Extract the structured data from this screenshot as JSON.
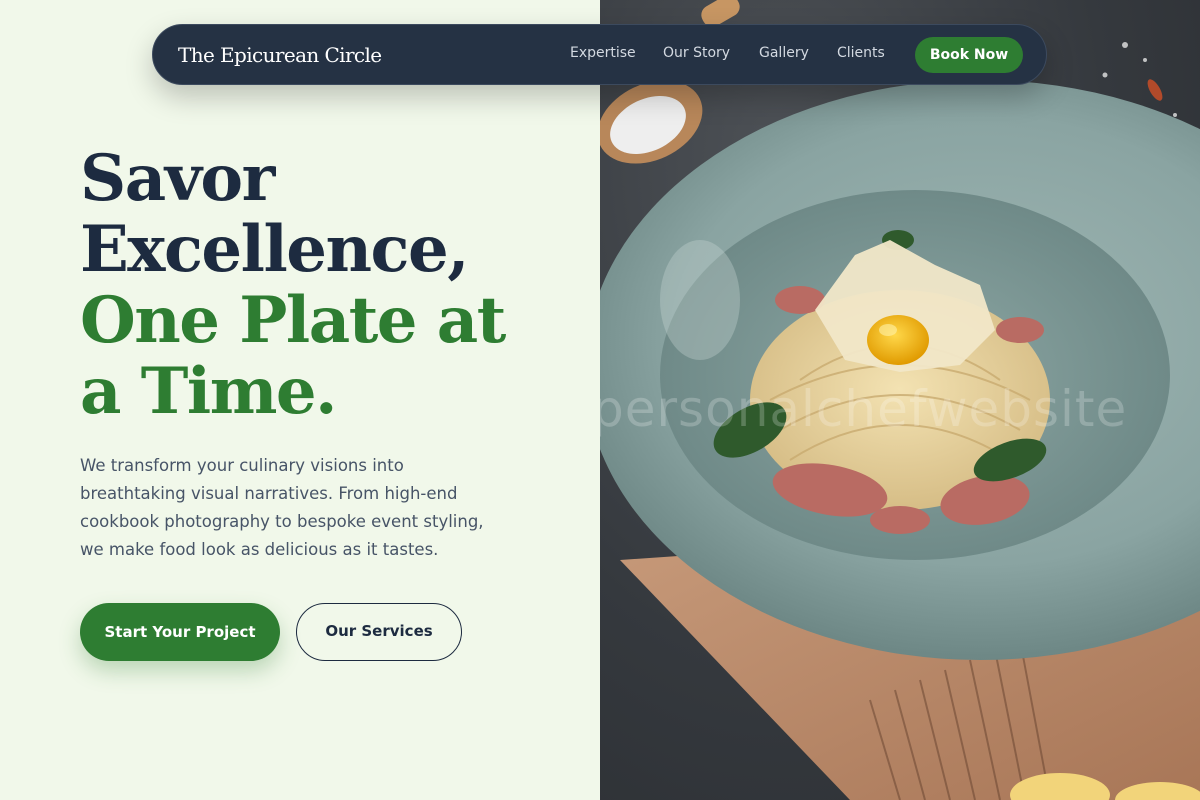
{
  "nav": {
    "brand": "The Epicurean Circle",
    "links": [
      "Expertise",
      "Our Story",
      "Gallery",
      "Clients"
    ],
    "cta": "Book Now"
  },
  "hero": {
    "headline_line1": "Savor",
    "headline_line2": "Excellence,",
    "headline_line3": "One Plate at",
    "headline_line4": "a Time.",
    "description": "We transform your culinary visions into breathtaking visual narratives. From high-end cookbook photography to bespoke event styling, we make food look as delicious as it tastes.",
    "primary_button": "Start Your Project",
    "secondary_button": "Our Services"
  },
  "image": {
    "watermark": "personalchefwebsite"
  },
  "colors": {
    "background": "#f1f8ea",
    "nav_background": "#253244",
    "accent_green": "#2e7d32",
    "headline_navy": "#1d2b40",
    "body_text": "#475467"
  }
}
